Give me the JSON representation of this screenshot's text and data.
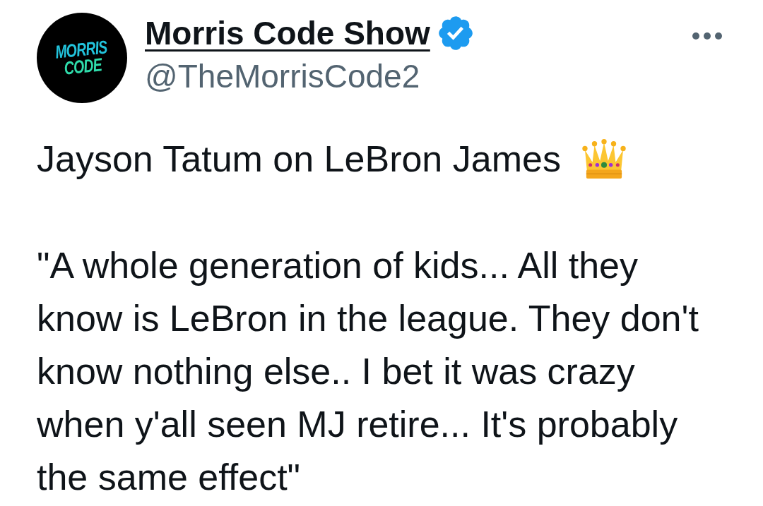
{
  "post": {
    "author": {
      "avatar_logo": [
        "MORRIS",
        "CODE"
      ],
      "name": "Morris Code Show",
      "verified": true,
      "handle": "@TheMorrisCode2"
    },
    "headline": "Jayson Tatum on LeBron James",
    "quote_lines": [
      "\"A whole generation of kids... All they",
      "know is LeBron in the league. They don't",
      "know nothing else.. I bet it was crazy",
      "when y'all seen MJ retire... It's probably",
      "the same effect\""
    ]
  }
}
